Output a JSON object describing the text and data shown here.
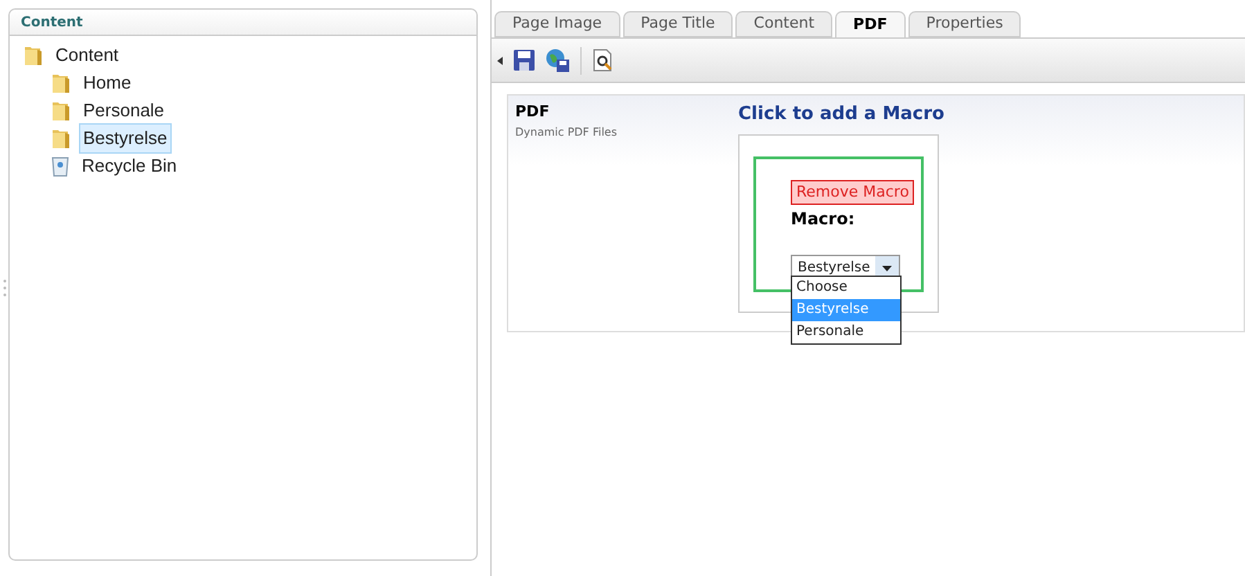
{
  "tree_panel": {
    "title": "Content",
    "items": [
      {
        "label": "Content",
        "kind": "folder",
        "selected": false,
        "children": [
          {
            "label": "Home",
            "kind": "folder",
            "selected": false
          },
          {
            "label": "Personale",
            "kind": "folder",
            "selected": false
          },
          {
            "label": "Bestyrelse",
            "kind": "folder",
            "selected": true
          },
          {
            "label": "Recycle Bin",
            "kind": "bin",
            "selected": false
          }
        ]
      }
    ]
  },
  "tabs": [
    {
      "label": "Page Image",
      "selected": false
    },
    {
      "label": "Page Title",
      "selected": false
    },
    {
      "label": "Content",
      "selected": false
    },
    {
      "label": "PDF",
      "selected": true
    },
    {
      "label": "Properties",
      "selected": false
    }
  ],
  "property": {
    "name": "PDF",
    "description": "Dynamic PDF Files"
  },
  "macro": {
    "add_link": "Click to add a Macro",
    "remove_button": "Remove Macro",
    "label": "Macro:",
    "select_value": "Bestyrelse",
    "options": [
      {
        "label": "Choose",
        "selected": false
      },
      {
        "label": "Bestyrelse",
        "selected": true
      },
      {
        "label": "Personale",
        "selected": false
      }
    ]
  }
}
